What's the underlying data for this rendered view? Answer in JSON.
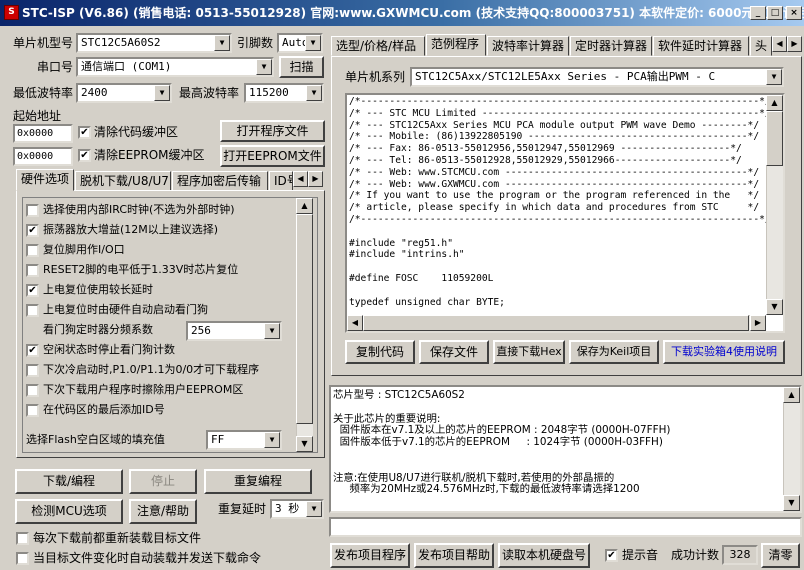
{
  "window": {
    "title": "STC-ISP (V6.86) (销售电话: 0513-55012928) 官网:www.GXWMCU.com  (技术支持QQ:800003751) 本软件定价: 6000元(可免试用)",
    "icon_label": "S",
    "minimize_label": "_",
    "maximize_label": "□",
    "close_label": "×"
  },
  "left": {
    "mcu_model_label": "单片机型号",
    "mcu_model_value": "STC12C5A60S2",
    "pin_count_label": "引脚数",
    "pin_count_value": "Auto",
    "serial_port_label": "串口号",
    "serial_port_value": "通信端口 (COM1)",
    "scan_button": "扫描",
    "min_baud_label": "最低波特率",
    "min_baud_value": "2400",
    "max_baud_label": "最高波特率",
    "max_baud_value": "115200",
    "start_addr_label": "起始地址",
    "addr1_value": "0x0000",
    "addr2_value": "0x0000",
    "clear_code_label": "清除代码缓冲区",
    "clear_eeprom_label": "清除EEPROM缓冲区",
    "open_program_button": "打开程序文件",
    "open_eeprom_button": "打开EEPROM文件",
    "tabs": [
      "硬件选项",
      "脱机下载/U8/U7",
      "程序加密后传输",
      "ID号"
    ],
    "options": [
      {
        "label": "选择使用内部IRC时钟(不选为外部时钟)",
        "checked": false
      },
      {
        "label": "振荡器放大增益(12M以上建议选择)",
        "checked": true
      },
      {
        "label": "复位脚用作I/O口",
        "checked": false
      },
      {
        "label": "RESET2脚的电平低于1.33V时芯片复位",
        "checked": false
      },
      {
        "label": "上电复位使用较长延时",
        "checked": true
      },
      {
        "label": "上电复位时由硬件自动启动看门狗",
        "checked": false
      }
    ],
    "watchdog_prescale_label": "看门狗定时器分频系数",
    "watchdog_prescale_value": "256",
    "options2": [
      {
        "label": "空闲状态时停止看门狗计数",
        "checked": true
      },
      {
        "label": "下次冷启动时,P1.0/P1.1为0/0才可下载程序",
        "checked": false
      },
      {
        "label": "下次下载用户程序时擦除用户EEPROM区",
        "checked": false
      },
      {
        "label": "在代码区的最后添加ID号",
        "checked": false
      }
    ],
    "fill_value_label": "选择Flash空白区域的填充值",
    "fill_value": "FF",
    "download_button": "下载/编程",
    "stop_button": "停止",
    "reprogram_button": "重复编程",
    "detect_mcu_button": "检测MCU选项",
    "help_button": "注意/帮助",
    "repeat_delay_label": "重复延时",
    "repeat_delay_value": "3 秒",
    "reload_before_download_label": "每次下载前都重新装载目标文件",
    "auto_download_label": "当目标文件变化时自动装载并发送下载命令"
  },
  "right": {
    "tabs": [
      "选型/价格/样品",
      "范例程序",
      "波特率计算器",
      "定时器计算器",
      "软件延时计算器",
      "头"
    ],
    "series_label": "单片机系列",
    "series_value": "STC12C5Axx/STC12LE5Axx Series - PCA输出PWM - C",
    "code_text": "/*---------------------------------------------------------------------*/\n/* --- STC MCU Limited ------------------------------------------------*/\n/* --- STC12C5Axx Series MCU PCA module output PWM wave Demo --------*/\n/* --- Mobile: (86)13922805190 --------------------------------------*/\n/* --- Fax: 86-0513-55012956,55012947,55012969 -------------------*/\n/* --- Tel: 86-0513-55012928,55012929,55012966--------------------*/\n/* --- Web: www.STCMCU.com ------------------------------------------*/\n/* --- Web: www.GXWMCU.com ------------------------------------------*/\n/* If you want to use the program or the program referenced in the   */\n/* article, please specify in which data and procedures from STC     */\n/*---------------------------------------------------------------------*/\n\n#include \"reg51.h\"\n#include \"intrins.h\"\n\n#define FOSC    11059200L\n\ntypedef unsigned char BYTE;",
    "copy_code_button": "复制代码",
    "save_file_button": "保存文件",
    "download_hex_button": "直接下载Hex",
    "save_keil_button": "保存为Keil项目",
    "exp_box_link": "下载实验箱4使用说明",
    "info_text": "芯片型号 : STC12C5A60S2\n\n关于此芯片的重要说明:\n  固件版本在v7.1及以上的芯片的EEPROM : 2048字节 (0000H-07FFH)\n  固件版本低于v7.1的芯片的EEPROM     : 1024字节 (0000H-03FFH)\n\n\n注意:在使用U8/U7进行联机/脱机下载时,若使用的外部晶振的\n     频率为20MHz或24.576MHz时,下载的最低波特率请选择1200",
    "publish_program_button": "发布项目程序",
    "publish_help_button": "发布项目帮助",
    "read_disk_button": "读取本机硬盘号",
    "beep_label": "提示音",
    "success_count_label": "成功计数",
    "success_count_value": "328",
    "clear_button": "清零"
  }
}
